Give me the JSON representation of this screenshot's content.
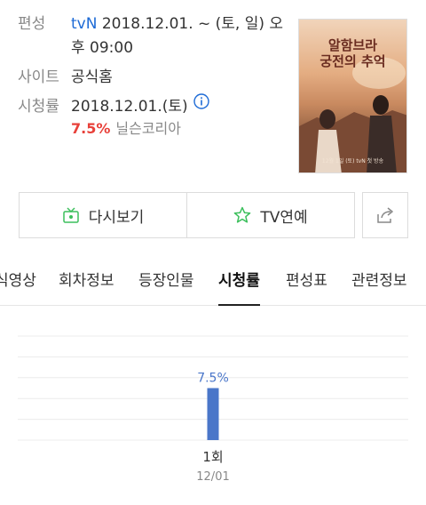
{
  "info": {
    "broadcast_label": "편성",
    "channel": "tvN",
    "schedule": "2018.12.01. ~ (토, 일) 오후 09:00",
    "site_label": "사이트",
    "site_link": "공식홈",
    "rating_label": "시청률",
    "rating_date": "2018.12.01.(토)",
    "rating_value": "7.5%",
    "rating_source": "닐슨코리아"
  },
  "poster": {
    "title_line1": "알함브라",
    "title_line2": "궁전의 추억",
    "premiere_text": "12월 1일 (토) tvN 첫 방송"
  },
  "actions": {
    "replay_label": "다시보기",
    "entertainment_label": "TV연예"
  },
  "tabs": [
    {
      "label": "식영상",
      "active": false
    },
    {
      "label": "회차정보",
      "active": false
    },
    {
      "label": "등장인물",
      "active": false
    },
    {
      "label": "시청률",
      "active": true
    },
    {
      "label": "편성표",
      "active": false
    },
    {
      "label": "관련정보",
      "active": false
    }
  ],
  "colors": {
    "accent_blue": "#1e6bd6",
    "rating_red": "#e8413a",
    "bar_blue": "#4a76c9",
    "replay_green": "#3cbf5c"
  },
  "chart_data": {
    "type": "bar",
    "categories": [
      "1회"
    ],
    "sublabels": [
      "12/01"
    ],
    "values": [
      7.5
    ],
    "data_labels": [
      "7.5%"
    ],
    "ylim": [
      0,
      15
    ],
    "grid": true
  }
}
